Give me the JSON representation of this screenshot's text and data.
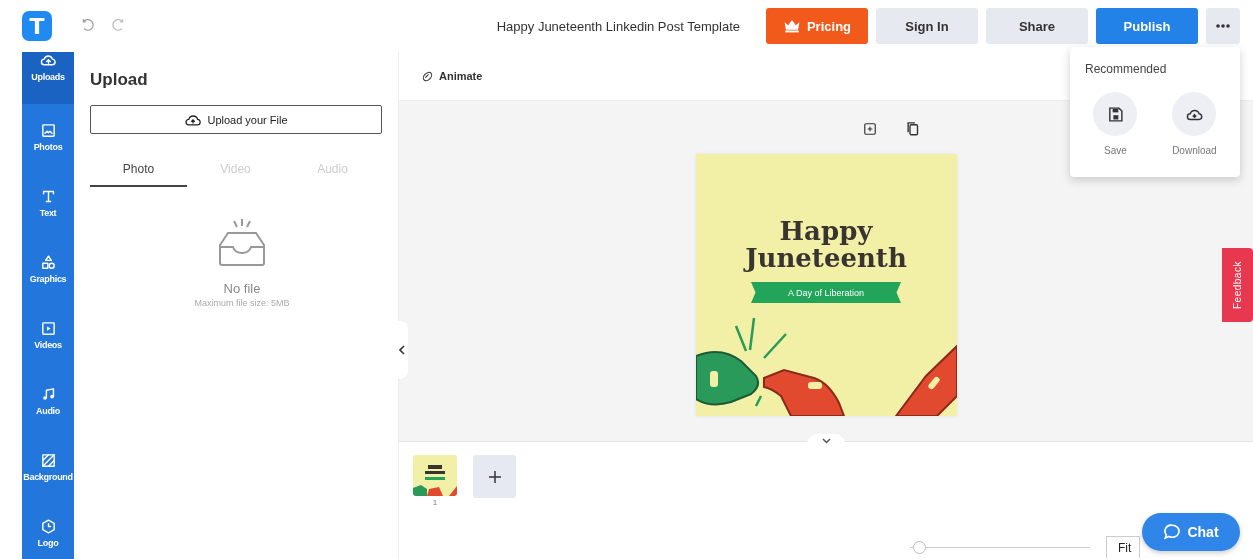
{
  "topbar": {
    "logo": "T",
    "title": "Happy Juneteenth Linkedin Post Template",
    "buttons": [
      {
        "label": "Pricing",
        "kind": "pricing"
      },
      {
        "label": "Sign In",
        "kind": "plain"
      },
      {
        "label": "Share",
        "kind": "plain"
      },
      {
        "label": "Publish",
        "kind": "primary"
      }
    ]
  },
  "sidebar": {
    "items": [
      {
        "label": "Uploads",
        "kind": "uploads",
        "selected": true
      },
      {
        "label": "Photos",
        "kind": "photos",
        "selected": false
      },
      {
        "label": "Text",
        "kind": "text",
        "selected": false
      },
      {
        "label": "Graphics",
        "kind": "graphics",
        "selected": false
      },
      {
        "label": "Videos",
        "kind": "videos",
        "selected": false
      },
      {
        "label": "Audio",
        "kind": "audio",
        "selected": false
      },
      {
        "label": "Background",
        "kind": "background",
        "selected": false
      },
      {
        "label": "Logo",
        "kind": "logo",
        "selected": false
      }
    ]
  },
  "panel": {
    "title": "Upload",
    "upload_button": "Upload your File",
    "tabs": [
      {
        "label": "Photo",
        "selected": true
      },
      {
        "label": "Video",
        "selected": false
      },
      {
        "label": "Audio",
        "selected": false
      }
    ],
    "empty_state": {
      "title": "No file",
      "note": "Maximum file size: 5MB"
    }
  },
  "editor": {
    "animate": "Animate",
    "design": {
      "heading_lines": [
        "Happy",
        "Juneteenth"
      ],
      "ribbon": "A Day of Liberation"
    },
    "pages": [
      {
        "number": "1"
      }
    ],
    "zoom": {
      "level": 0.05,
      "fit": "Fit"
    }
  },
  "popup": {
    "title": "Recommended",
    "actions": [
      {
        "label": "Save",
        "kind": "save"
      },
      {
        "label": "Download",
        "kind": "download"
      }
    ]
  },
  "feedback": "Feedback",
  "chat": "Chat"
}
